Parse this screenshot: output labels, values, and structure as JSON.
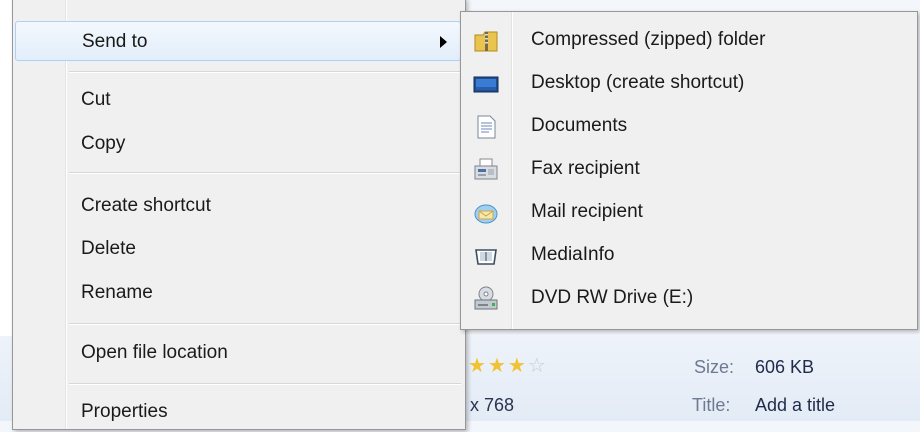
{
  "context_menu": {
    "send_to": "Send to",
    "cut": "Cut",
    "copy": "Copy",
    "create_shortcut": "Create shortcut",
    "delete": "Delete",
    "rename": "Rename",
    "open_file_location": "Open file location",
    "properties": "Properties"
  },
  "send_to_submenu": {
    "items": [
      {
        "label": "Compressed (zipped) folder",
        "icon": "zip-folder-icon"
      },
      {
        "label": "Desktop (create shortcut)",
        "icon": "desktop-icon"
      },
      {
        "label": "Documents",
        "icon": "documents-icon"
      },
      {
        "label": "Fax recipient",
        "icon": "fax-icon"
      },
      {
        "label": "Mail recipient",
        "icon": "mail-icon"
      },
      {
        "label": "MediaInfo",
        "icon": "mediainfo-icon"
      },
      {
        "label": "DVD RW Drive (E:)",
        "icon": "dvd-drive-icon"
      }
    ]
  },
  "details_pane": {
    "rating_stars_filled": 3,
    "rating_stars_total": 4,
    "dimensions_partial": "x 768",
    "size_label": "Size:",
    "size_value": "606 KB",
    "title_label": "Title:",
    "title_value": "Add a title"
  },
  "colors": {
    "menu_background": "#f0f0f0",
    "highlight_border": "#aecff7",
    "star_filled": "#f1c232"
  }
}
